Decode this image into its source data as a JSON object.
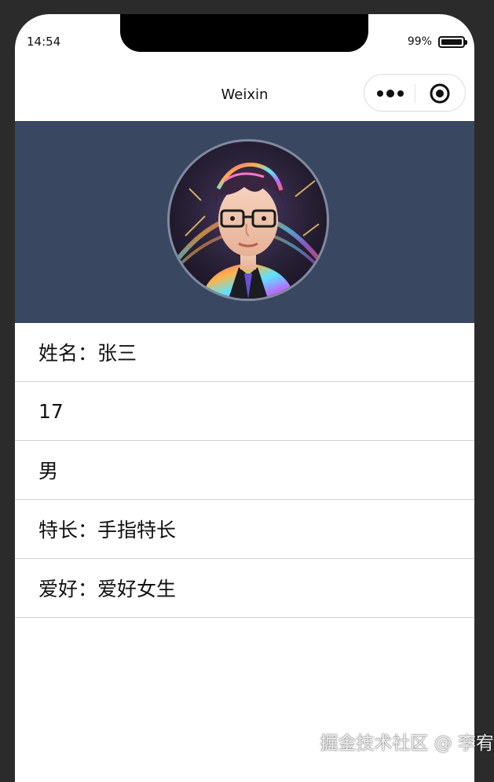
{
  "status_bar": {
    "time": "14:54",
    "battery_percent": "99%",
    "battery_level": 0.99
  },
  "navbar": {
    "title": "Weixin",
    "more_icon": "more-dots-icon",
    "close_icon": "target-circle-icon"
  },
  "header": {
    "background": "#3a4760",
    "avatar_icon": "avatar"
  },
  "info": {
    "items": [
      {
        "label": "姓名：张三"
      },
      {
        "label": "17"
      },
      {
        "label": "男"
      },
      {
        "label": "特长：手指特长"
      },
      {
        "label": "爱好：爱好女生"
      }
    ]
  },
  "watermark": {
    "text": "掘金技术社区 @ 李宥"
  }
}
